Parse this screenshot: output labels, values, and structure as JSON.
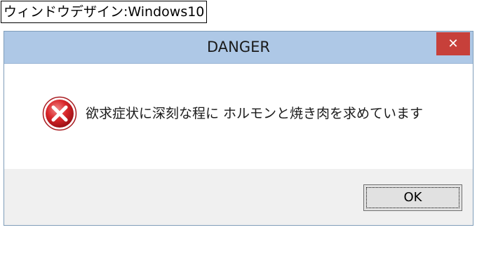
{
  "caption": "ウィンドウデザイン:Windows10",
  "dialog": {
    "title": "DANGER",
    "close_label": "✕",
    "message": "欲求症状に深刻な程に ホルモンと焼き肉を求めています",
    "icon": "error-icon",
    "ok_label": "OK"
  }
}
